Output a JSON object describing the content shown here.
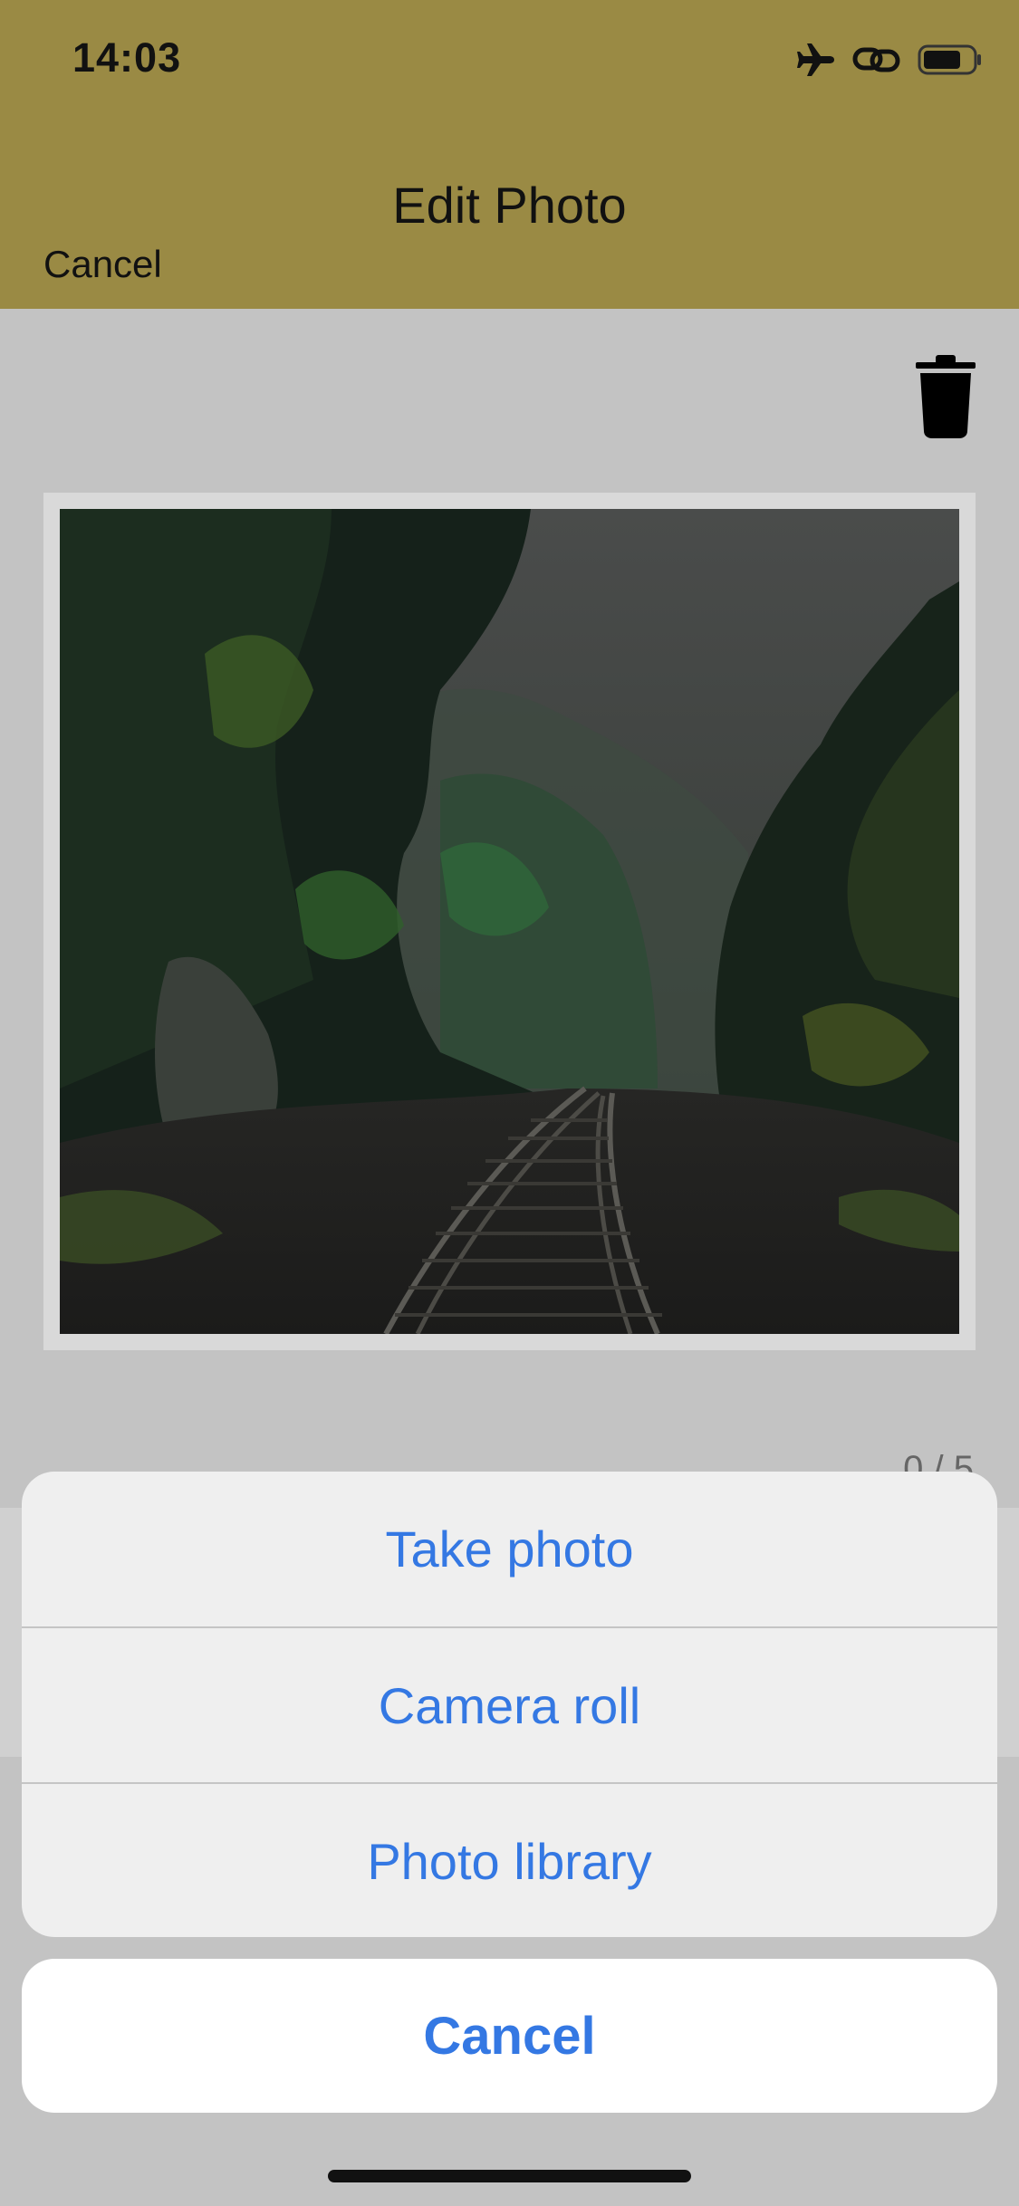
{
  "status_bar": {
    "time": "14:03",
    "icons": [
      "airplane-icon",
      "link-icon",
      "battery-icon"
    ]
  },
  "header": {
    "title": "Edit Photo",
    "cancel_label": "Cancel",
    "background_color": "#9a8a44"
  },
  "toolbar": {
    "icon": "trash-icon"
  },
  "photo": {
    "description_icon": "forest-railway-photo"
  },
  "counter": {
    "text": "0 / 5"
  },
  "action_sheet": {
    "items": [
      {
        "label": "Take photo"
      },
      {
        "label": "Camera roll"
      },
      {
        "label": "Photo library"
      }
    ],
    "cancel_label": "Cancel",
    "accent_color": "#3478e3"
  }
}
